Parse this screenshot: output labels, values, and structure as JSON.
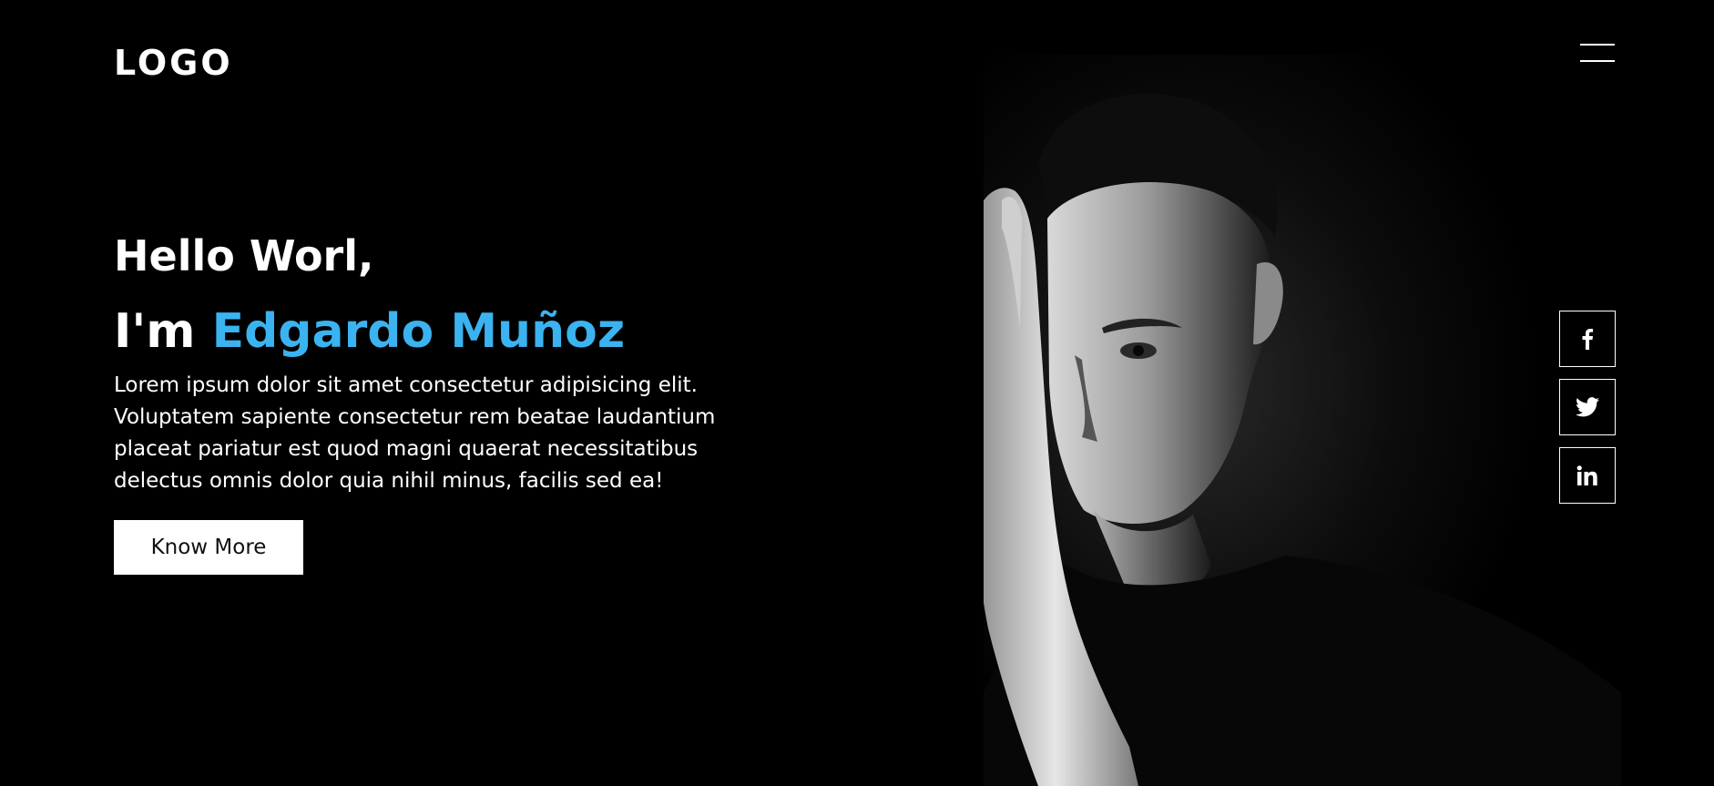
{
  "header": {
    "logo": "LOGO",
    "menu_icon": "hamburger-menu-icon"
  },
  "hero": {
    "greeting": "Hello Worl,",
    "intro_prefix": "I'm",
    "name": "Edgardo Muñoz",
    "description": "Lorem ipsum dolor sit amet consectetur adipisicing elit. Voluptatem sapiente consectetur rem beatae laudantium placeat pariatur est quod magni quaerat necessitatibus delectus omnis dolor quia nihil minus, facilis sed ea!",
    "button_label": "Know More"
  },
  "social": [
    {
      "icon": "facebook-icon"
    },
    {
      "icon": "twitter-icon"
    },
    {
      "icon": "linkedin-icon"
    }
  ],
  "colors": {
    "background": "#000000",
    "accent": "#3bb3f0",
    "text": "#ffffff"
  }
}
